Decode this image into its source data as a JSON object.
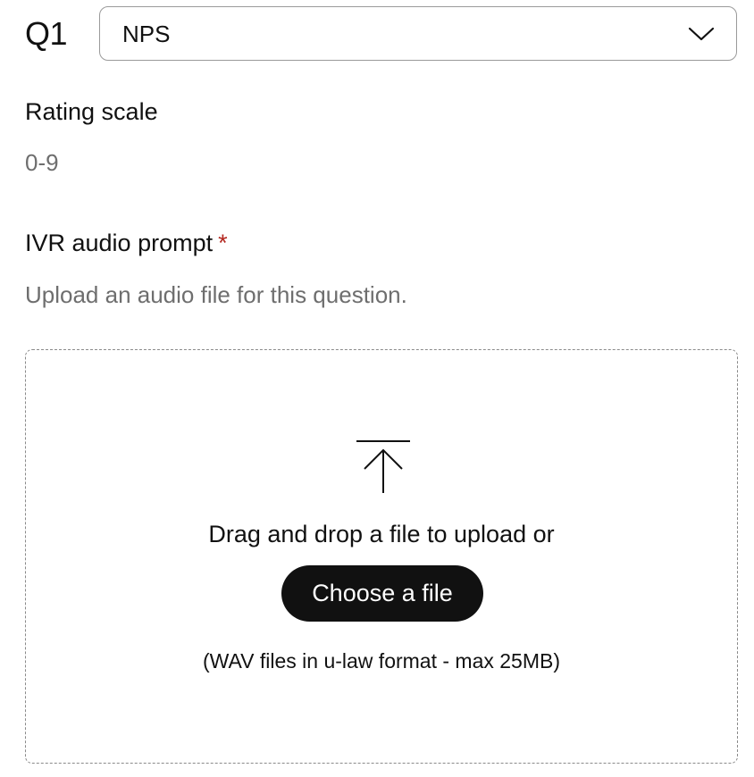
{
  "question": {
    "label": "Q1",
    "type_select": {
      "value": "NPS",
      "chevron_icon": "chevron-down-icon"
    }
  },
  "rating_scale": {
    "label": "Rating scale",
    "value": "0-9"
  },
  "ivr_prompt": {
    "label": "IVR audio prompt",
    "required_marker": "*",
    "description": "Upload an audio file for this question."
  },
  "upload": {
    "icon": "upload-icon",
    "drag_text": "Drag and drop a file to upload or",
    "choose_button_label": "Choose a file",
    "hint": "(WAV files in u-law format - max 25MB)"
  },
  "colors": {
    "required": "#b3261e",
    "button_bg": "#111111",
    "button_text": "#ffffff",
    "muted_text": "#6e6e6e"
  }
}
